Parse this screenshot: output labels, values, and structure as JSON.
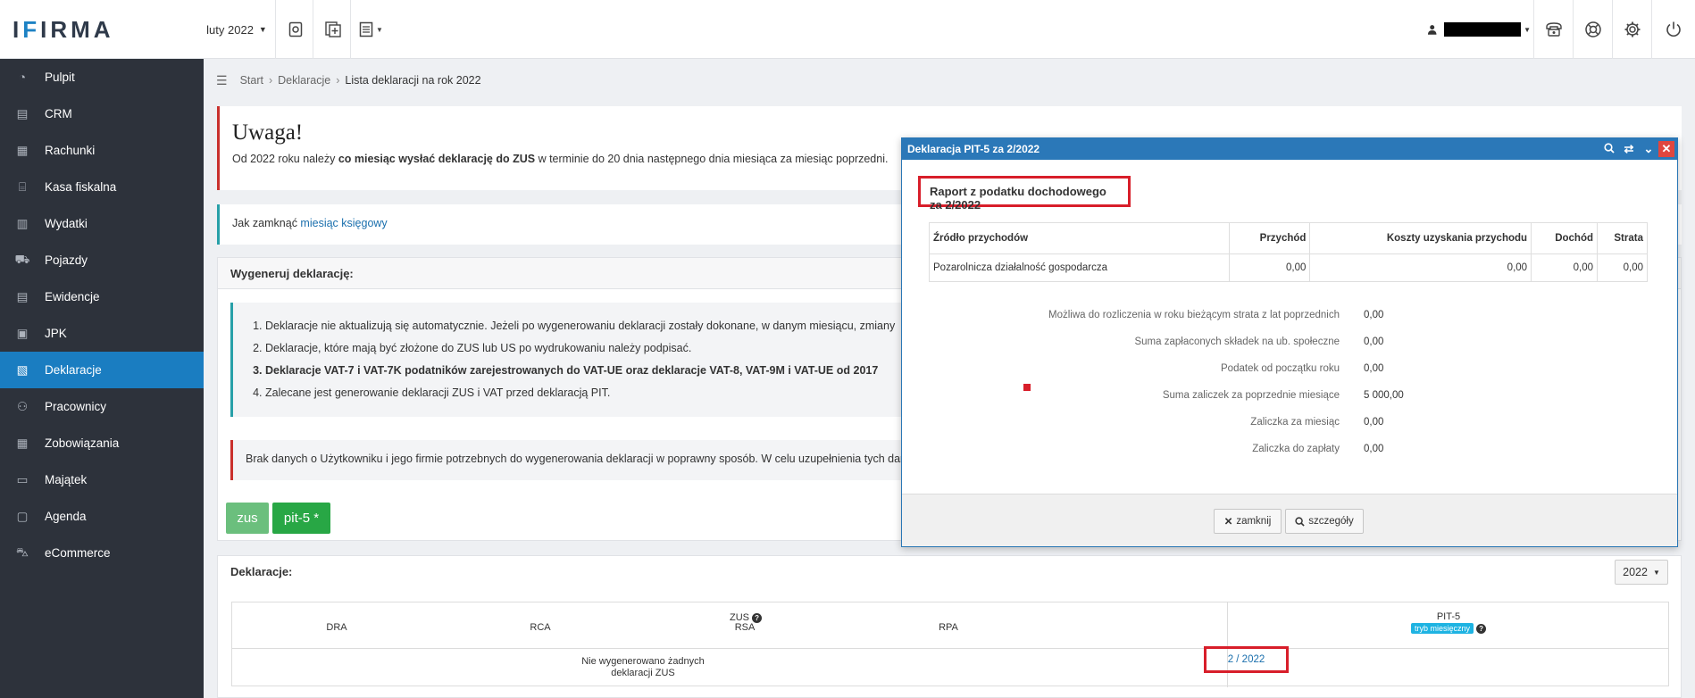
{
  "app": {
    "logo": "IFIRMA",
    "month": "luty 2022"
  },
  "sidebar": {
    "items": [
      {
        "label": "Pulpit",
        "icon": "dashboard-icon"
      },
      {
        "label": "CRM",
        "icon": "crm-icon"
      },
      {
        "label": "Rachunki",
        "icon": "invoice-icon"
      },
      {
        "label": "Kasa fiskalna",
        "icon": "cash-register-icon"
      },
      {
        "label": "Wydatki",
        "icon": "expenses-icon"
      },
      {
        "label": "Pojazdy",
        "icon": "car-icon"
      },
      {
        "label": "Ewidencje",
        "icon": "records-icon"
      },
      {
        "label": "JPK",
        "icon": "jpk-icon"
      },
      {
        "label": "Deklaracje",
        "icon": "declarations-icon",
        "active": true
      },
      {
        "label": "Pracownicy",
        "icon": "employees-icon"
      },
      {
        "label": "Zobowiązania",
        "icon": "liabilities-icon"
      },
      {
        "label": "Majątek",
        "icon": "assets-icon"
      },
      {
        "label": "Agenda",
        "icon": "agenda-icon"
      },
      {
        "label": "eCommerce",
        "icon": "cart-icon"
      }
    ]
  },
  "breadcrumb": {
    "start": "Start",
    "deklaracje": "Deklaracje",
    "current": "Lista deklaracji na rok 2022"
  },
  "uwaga": {
    "title": "Uwaga!",
    "text_pre": "Od 2022 roku należy ",
    "text_bold": "co miesiąc wysłać deklarację do ZUS",
    "text_post": " w terminie do 20 dnia następnego dnia miesiąca za miesiąc poprzedni."
  },
  "jak": {
    "text": "Jak zamknąć ",
    "link": "miesiąc księgowy"
  },
  "generate": {
    "title": "Wygeneruj deklarację:",
    "info": [
      "Deklaracje nie aktualizują się automatycznie. Jeżeli po wygenerowaniu deklaracji zostały dokonane, w danym miesiącu, zmiany",
      "Deklaracje, które mają być złożone do ZUS lub US po wydrukowaniu należy podpisać.",
      "Deklaracje VAT-7 i VAT-7K podatników zarejestrowanych do VAT-UE oraz deklaracje VAT-8, VAT-9M i VAT-UE od 2017",
      "Zalecane jest generowanie deklaracji ZUS i VAT przed deklaracją PIT."
    ],
    "warning": "Brak danych o Użytkowniku i jego firmie potrzebnych do wygenerowania deklaracji w poprawny sposób. W celu uzupełnienia tych danych",
    "btn_zus": "zus",
    "btn_pit": "pit-5 *"
  },
  "declarations": {
    "title": "Deklaracje:",
    "year": "2022",
    "zus_header": "ZUS",
    "cols": [
      "DRA",
      "RCA",
      "RSA",
      "RPA"
    ],
    "pit_header": "PIT-5",
    "pit_badge": "tryb miesięczny",
    "none_text_1": "Nie wygenerowano żadnych",
    "none_text_2": "deklaracji ZUS",
    "pit_value": "2 / 2022"
  },
  "modal": {
    "title": "Deklaracja PIT-5 za 2/2022",
    "subtitle": "Raport z podatku dochodowego za 2/2022",
    "table_headers": [
      "Źródło przychodów",
      "Przychód",
      "Koszty uzyskania przychodu",
      "Dochód",
      "Strata"
    ],
    "table_row": [
      "Pozarolnicza działalność gospodarcza",
      "0,00",
      "0,00",
      "0,00",
      "0,00"
    ],
    "summary": [
      {
        "label": "Możliwa do rozliczenia w roku bieżącym strata z lat poprzednich",
        "value": "0,00"
      },
      {
        "label": "Suma zapłaconych składek na ub. społeczne",
        "value": "0,00"
      },
      {
        "label": "Podatek od początku roku",
        "value": "0,00"
      },
      {
        "label": "Suma zaliczek za poprzednie miesiące",
        "value": "5 000,00"
      },
      {
        "label": "Zaliczka za miesiąc",
        "value": "0,00"
      },
      {
        "label": "Zaliczka do zapłaty",
        "value": "0,00"
      }
    ],
    "btn_close": "zamknij",
    "btn_details": "szczegóły"
  }
}
